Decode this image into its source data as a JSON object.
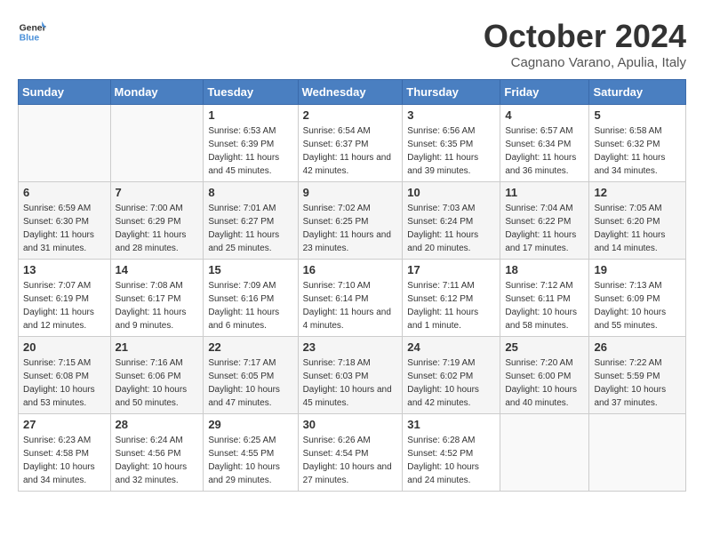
{
  "header": {
    "logo_line1": "General",
    "logo_line2": "Blue",
    "month": "October 2024",
    "location": "Cagnano Varano, Apulia, Italy"
  },
  "days_of_week": [
    "Sunday",
    "Monday",
    "Tuesday",
    "Wednesday",
    "Thursday",
    "Friday",
    "Saturday"
  ],
  "weeks": [
    [
      {
        "day": "",
        "info": ""
      },
      {
        "day": "",
        "info": ""
      },
      {
        "day": "1",
        "info": "Sunrise: 6:53 AM\nSunset: 6:39 PM\nDaylight: 11 hours and 45 minutes."
      },
      {
        "day": "2",
        "info": "Sunrise: 6:54 AM\nSunset: 6:37 PM\nDaylight: 11 hours and 42 minutes."
      },
      {
        "day": "3",
        "info": "Sunrise: 6:56 AM\nSunset: 6:35 PM\nDaylight: 11 hours and 39 minutes."
      },
      {
        "day": "4",
        "info": "Sunrise: 6:57 AM\nSunset: 6:34 PM\nDaylight: 11 hours and 36 minutes."
      },
      {
        "day": "5",
        "info": "Sunrise: 6:58 AM\nSunset: 6:32 PM\nDaylight: 11 hours and 34 minutes."
      }
    ],
    [
      {
        "day": "6",
        "info": "Sunrise: 6:59 AM\nSunset: 6:30 PM\nDaylight: 11 hours and 31 minutes."
      },
      {
        "day": "7",
        "info": "Sunrise: 7:00 AM\nSunset: 6:29 PM\nDaylight: 11 hours and 28 minutes."
      },
      {
        "day": "8",
        "info": "Sunrise: 7:01 AM\nSunset: 6:27 PM\nDaylight: 11 hours and 25 minutes."
      },
      {
        "day": "9",
        "info": "Sunrise: 7:02 AM\nSunset: 6:25 PM\nDaylight: 11 hours and 23 minutes."
      },
      {
        "day": "10",
        "info": "Sunrise: 7:03 AM\nSunset: 6:24 PM\nDaylight: 11 hours and 20 minutes."
      },
      {
        "day": "11",
        "info": "Sunrise: 7:04 AM\nSunset: 6:22 PM\nDaylight: 11 hours and 17 minutes."
      },
      {
        "day": "12",
        "info": "Sunrise: 7:05 AM\nSunset: 6:20 PM\nDaylight: 11 hours and 14 minutes."
      }
    ],
    [
      {
        "day": "13",
        "info": "Sunrise: 7:07 AM\nSunset: 6:19 PM\nDaylight: 11 hours and 12 minutes."
      },
      {
        "day": "14",
        "info": "Sunrise: 7:08 AM\nSunset: 6:17 PM\nDaylight: 11 hours and 9 minutes."
      },
      {
        "day": "15",
        "info": "Sunrise: 7:09 AM\nSunset: 6:16 PM\nDaylight: 11 hours and 6 minutes."
      },
      {
        "day": "16",
        "info": "Sunrise: 7:10 AM\nSunset: 6:14 PM\nDaylight: 11 hours and 4 minutes."
      },
      {
        "day": "17",
        "info": "Sunrise: 7:11 AM\nSunset: 6:12 PM\nDaylight: 11 hours and 1 minute."
      },
      {
        "day": "18",
        "info": "Sunrise: 7:12 AM\nSunset: 6:11 PM\nDaylight: 10 hours and 58 minutes."
      },
      {
        "day": "19",
        "info": "Sunrise: 7:13 AM\nSunset: 6:09 PM\nDaylight: 10 hours and 55 minutes."
      }
    ],
    [
      {
        "day": "20",
        "info": "Sunrise: 7:15 AM\nSunset: 6:08 PM\nDaylight: 10 hours and 53 minutes."
      },
      {
        "day": "21",
        "info": "Sunrise: 7:16 AM\nSunset: 6:06 PM\nDaylight: 10 hours and 50 minutes."
      },
      {
        "day": "22",
        "info": "Sunrise: 7:17 AM\nSunset: 6:05 PM\nDaylight: 10 hours and 47 minutes."
      },
      {
        "day": "23",
        "info": "Sunrise: 7:18 AM\nSunset: 6:03 PM\nDaylight: 10 hours and 45 minutes."
      },
      {
        "day": "24",
        "info": "Sunrise: 7:19 AM\nSunset: 6:02 PM\nDaylight: 10 hours and 42 minutes."
      },
      {
        "day": "25",
        "info": "Sunrise: 7:20 AM\nSunset: 6:00 PM\nDaylight: 10 hours and 40 minutes."
      },
      {
        "day": "26",
        "info": "Sunrise: 7:22 AM\nSunset: 5:59 PM\nDaylight: 10 hours and 37 minutes."
      }
    ],
    [
      {
        "day": "27",
        "info": "Sunrise: 6:23 AM\nSunset: 4:58 PM\nDaylight: 10 hours and 34 minutes."
      },
      {
        "day": "28",
        "info": "Sunrise: 6:24 AM\nSunset: 4:56 PM\nDaylight: 10 hours and 32 minutes."
      },
      {
        "day": "29",
        "info": "Sunrise: 6:25 AM\nSunset: 4:55 PM\nDaylight: 10 hours and 29 minutes."
      },
      {
        "day": "30",
        "info": "Sunrise: 6:26 AM\nSunset: 4:54 PM\nDaylight: 10 hours and 27 minutes."
      },
      {
        "day": "31",
        "info": "Sunrise: 6:28 AM\nSunset: 4:52 PM\nDaylight: 10 hours and 24 minutes."
      },
      {
        "day": "",
        "info": ""
      },
      {
        "day": "",
        "info": ""
      }
    ]
  ]
}
